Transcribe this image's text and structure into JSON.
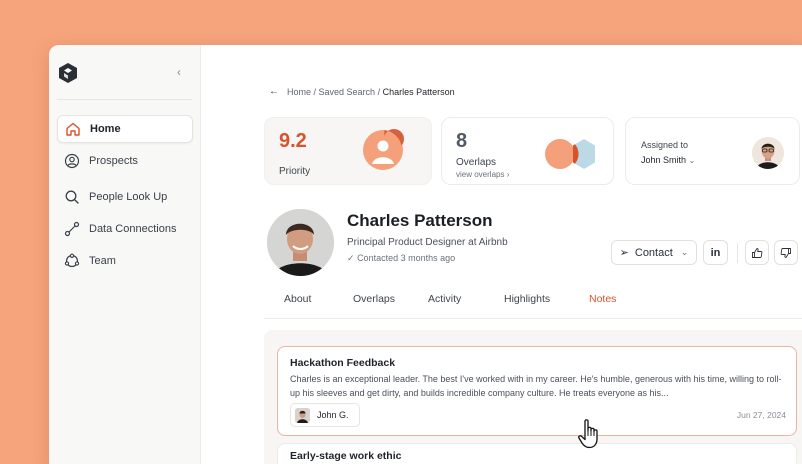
{
  "sidebar": {
    "items": [
      {
        "label": "Home",
        "icon": "home-icon"
      },
      {
        "label": "Prospects",
        "icon": "user-circle-icon"
      },
      {
        "label": "People Look Up",
        "icon": "search-icon"
      },
      {
        "label": "Data Connections",
        "icon": "connection-icon"
      },
      {
        "label": "Team",
        "icon": "team-icon"
      }
    ]
  },
  "breadcrumb": {
    "home": "Home",
    "saved": "Saved Search",
    "current": "Charles Patterson"
  },
  "stats": {
    "priority_value": "9.2",
    "priority_label": "Priority",
    "overlaps_value": "8",
    "overlaps_label": "Overlaps",
    "overlaps_link": "view overlaps",
    "assigned_label": "Assigned to",
    "assigned_name": "John Smith"
  },
  "profile": {
    "name": "Charles Patterson",
    "title": "Principal Product Designer at Airbnb",
    "contacted": "Contacted 3 months ago",
    "contact_button": "Contact",
    "linkedin_label": "in"
  },
  "tabs": [
    "About",
    "Overlaps",
    "Activity",
    "Highlights",
    "Notes"
  ],
  "active_tab": "Notes",
  "notes": [
    {
      "title": "Hackathon Feedback",
      "body": "Charles is an exceptional leader. The best I've worked with in my career. He's humble, generous with his time, willing to roll-up his sleeves and get dirty, and builds incredible company culture. He treats everyone as his...",
      "author": "John G.",
      "date": "Jun 27, 2024"
    },
    {
      "title": "Early-stage work ethic"
    }
  ],
  "colors": {
    "accent": "#d8532b",
    "background": "#f5a47c"
  }
}
